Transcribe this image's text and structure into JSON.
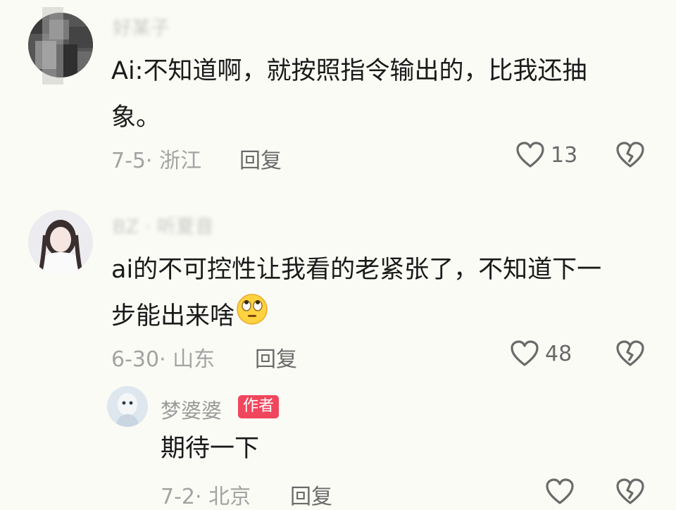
{
  "comments": [
    {
      "username": "好某子",
      "text_line1": "Ai:不知道啊，就按照指令输出的，比我还抽",
      "text_line2": "象。",
      "date": "7-5",
      "location": "浙江",
      "reply_label": "回复",
      "likes": "13"
    },
    {
      "username": "BZ · 听夏音",
      "text_line1": "ai的不可控性让我看的老紧张了，不知道下一",
      "text_line2": "步能出来啥",
      "date": "6-30",
      "location": "山东",
      "reply_label": "回复",
      "likes": "48",
      "emoji": "eye-rolling-face-emoji"
    }
  ],
  "reply": {
    "username": "梦婆婆",
    "badge": "作者",
    "text": "期待一下",
    "date": "7-2",
    "location": "北京",
    "reply_label": "回复",
    "likes": ""
  },
  "icons": [
    "heart-outline-icon",
    "broken-heart-icon"
  ],
  "colors": {
    "background": "#fbfbf6",
    "badge": "#f0465d",
    "meta": "#a3a3a3"
  }
}
